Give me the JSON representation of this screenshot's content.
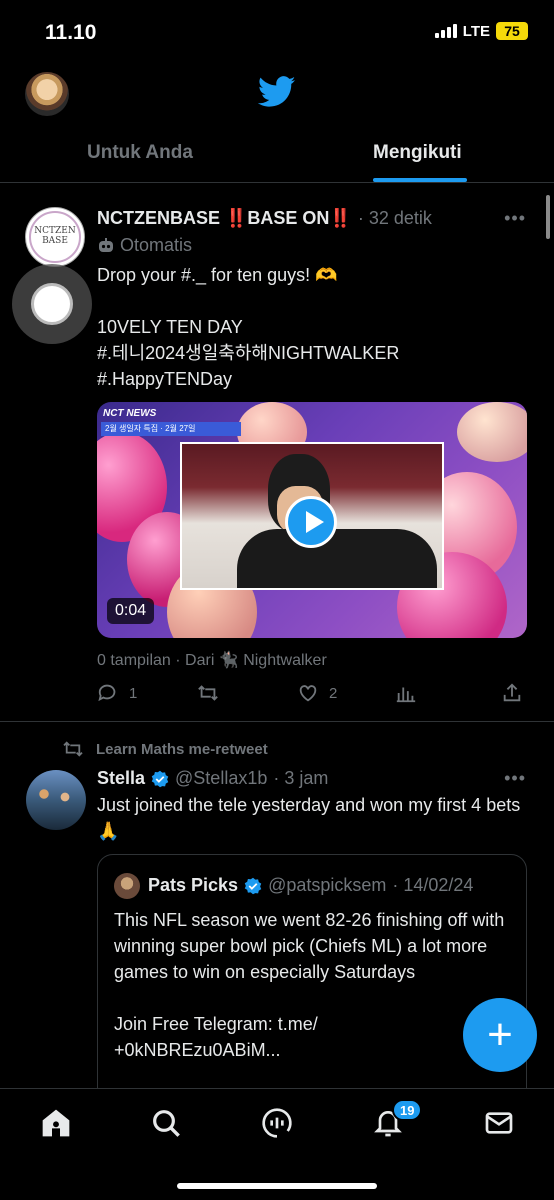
{
  "status_bar": {
    "time": "11.10",
    "network": "LTE",
    "battery": "75"
  },
  "header": {
    "tabs": [
      {
        "label": "Untuk Anda"
      },
      {
        "label": "Mengikuti"
      }
    ],
    "active_tab": "Mengikuti"
  },
  "tweets": [
    {
      "avatar_text": [
        "NCTZEN",
        "BASE"
      ],
      "name": "NCTZENBASE ‼️BASE ON‼️",
      "time": "· 32 detik",
      "automated_label": "Otomatis",
      "text": "Drop your #._ for ten guys! 🫶\n\n10VELY TEN DAY\n#.테니2024생일축하해NIGHTWALKER\n#.HappyTENDay",
      "video": {
        "logo": "NCT NEWS",
        "strip": "2월 생일자 특집 · 2월 27일",
        "duration": "0:04"
      },
      "views": "0 tampilan · Dari 🐈‍⬛ Nightwalker",
      "stats": {
        "replies": "1",
        "retweets": "",
        "likes": "2"
      }
    },
    {
      "retweeted_by": "Learn Maths me-retweet",
      "name": "Stella",
      "handle": "@Stellax1b",
      "time": "· 3 jam",
      "text": "Just joined the tele yesterday and won my first 4 bets🙏",
      "quote": {
        "name": "Pats Picks",
        "handle": "@patspicksem",
        "time": "· 14/02/24",
        "text": "This NFL season we went 82-26 finishing off with winning super bowl pick (Chiefs ML) a lot more games to win on especially Saturdays\n\nJoin Free Telegram: t.me/\n+0kNBREzu0ABiM..."
      }
    }
  ],
  "fab": {
    "label": "+"
  },
  "bottom_nav": {
    "items": [
      "home-icon",
      "search-icon",
      "spaces-icon",
      "notifications-icon",
      "messages-icon"
    ],
    "notification_count": "19"
  },
  "colors": {
    "accent": "#1d9bf0",
    "background": "#000000",
    "muted": "#71767b",
    "text": "#e7e9ea"
  }
}
